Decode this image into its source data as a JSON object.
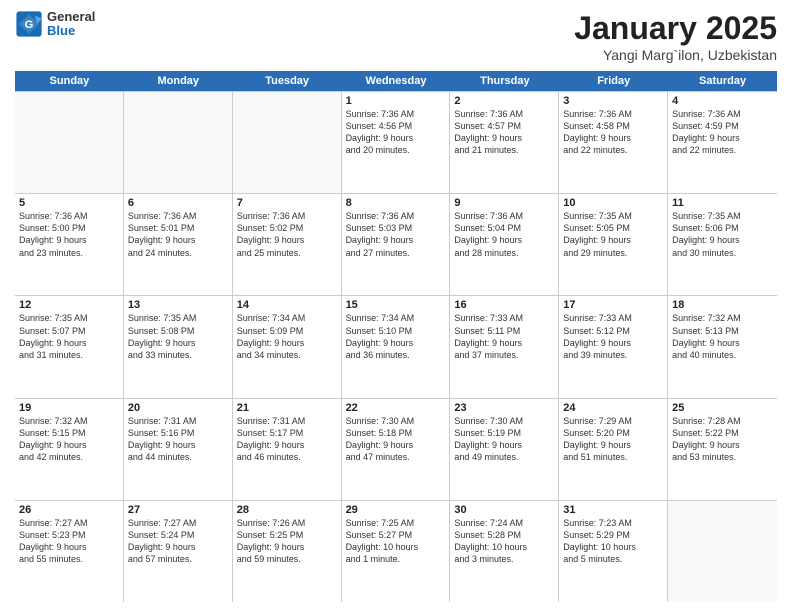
{
  "header": {
    "logo": {
      "line1": "General",
      "line2": "Blue"
    },
    "title": "January 2025",
    "subtitle": "Yangi Marg`ilon, Uzbekistan"
  },
  "weekdays": [
    "Sunday",
    "Monday",
    "Tuesday",
    "Wednesday",
    "Thursday",
    "Friday",
    "Saturday"
  ],
  "rows": [
    [
      {
        "day": "",
        "lines": []
      },
      {
        "day": "",
        "lines": []
      },
      {
        "day": "",
        "lines": []
      },
      {
        "day": "1",
        "lines": [
          "Sunrise: 7:36 AM",
          "Sunset: 4:56 PM",
          "Daylight: 9 hours",
          "and 20 minutes."
        ]
      },
      {
        "day": "2",
        "lines": [
          "Sunrise: 7:36 AM",
          "Sunset: 4:57 PM",
          "Daylight: 9 hours",
          "and 21 minutes."
        ]
      },
      {
        "day": "3",
        "lines": [
          "Sunrise: 7:36 AM",
          "Sunset: 4:58 PM",
          "Daylight: 9 hours",
          "and 22 minutes."
        ]
      },
      {
        "day": "4",
        "lines": [
          "Sunrise: 7:36 AM",
          "Sunset: 4:59 PM",
          "Daylight: 9 hours",
          "and 22 minutes."
        ]
      }
    ],
    [
      {
        "day": "5",
        "lines": [
          "Sunrise: 7:36 AM",
          "Sunset: 5:00 PM",
          "Daylight: 9 hours",
          "and 23 minutes."
        ]
      },
      {
        "day": "6",
        "lines": [
          "Sunrise: 7:36 AM",
          "Sunset: 5:01 PM",
          "Daylight: 9 hours",
          "and 24 minutes."
        ]
      },
      {
        "day": "7",
        "lines": [
          "Sunrise: 7:36 AM",
          "Sunset: 5:02 PM",
          "Daylight: 9 hours",
          "and 25 minutes."
        ]
      },
      {
        "day": "8",
        "lines": [
          "Sunrise: 7:36 AM",
          "Sunset: 5:03 PM",
          "Daylight: 9 hours",
          "and 27 minutes."
        ]
      },
      {
        "day": "9",
        "lines": [
          "Sunrise: 7:36 AM",
          "Sunset: 5:04 PM",
          "Daylight: 9 hours",
          "and 28 minutes."
        ]
      },
      {
        "day": "10",
        "lines": [
          "Sunrise: 7:35 AM",
          "Sunset: 5:05 PM",
          "Daylight: 9 hours",
          "and 29 minutes."
        ]
      },
      {
        "day": "11",
        "lines": [
          "Sunrise: 7:35 AM",
          "Sunset: 5:06 PM",
          "Daylight: 9 hours",
          "and 30 minutes."
        ]
      }
    ],
    [
      {
        "day": "12",
        "lines": [
          "Sunrise: 7:35 AM",
          "Sunset: 5:07 PM",
          "Daylight: 9 hours",
          "and 31 minutes."
        ]
      },
      {
        "day": "13",
        "lines": [
          "Sunrise: 7:35 AM",
          "Sunset: 5:08 PM",
          "Daylight: 9 hours",
          "and 33 minutes."
        ]
      },
      {
        "day": "14",
        "lines": [
          "Sunrise: 7:34 AM",
          "Sunset: 5:09 PM",
          "Daylight: 9 hours",
          "and 34 minutes."
        ]
      },
      {
        "day": "15",
        "lines": [
          "Sunrise: 7:34 AM",
          "Sunset: 5:10 PM",
          "Daylight: 9 hours",
          "and 36 minutes."
        ]
      },
      {
        "day": "16",
        "lines": [
          "Sunrise: 7:33 AM",
          "Sunset: 5:11 PM",
          "Daylight: 9 hours",
          "and 37 minutes."
        ]
      },
      {
        "day": "17",
        "lines": [
          "Sunrise: 7:33 AM",
          "Sunset: 5:12 PM",
          "Daylight: 9 hours",
          "and 39 minutes."
        ]
      },
      {
        "day": "18",
        "lines": [
          "Sunrise: 7:32 AM",
          "Sunset: 5:13 PM",
          "Daylight: 9 hours",
          "and 40 minutes."
        ]
      }
    ],
    [
      {
        "day": "19",
        "lines": [
          "Sunrise: 7:32 AM",
          "Sunset: 5:15 PM",
          "Daylight: 9 hours",
          "and 42 minutes."
        ]
      },
      {
        "day": "20",
        "lines": [
          "Sunrise: 7:31 AM",
          "Sunset: 5:16 PM",
          "Daylight: 9 hours",
          "and 44 minutes."
        ]
      },
      {
        "day": "21",
        "lines": [
          "Sunrise: 7:31 AM",
          "Sunset: 5:17 PM",
          "Daylight: 9 hours",
          "and 46 minutes."
        ]
      },
      {
        "day": "22",
        "lines": [
          "Sunrise: 7:30 AM",
          "Sunset: 5:18 PM",
          "Daylight: 9 hours",
          "and 47 minutes."
        ]
      },
      {
        "day": "23",
        "lines": [
          "Sunrise: 7:30 AM",
          "Sunset: 5:19 PM",
          "Daylight: 9 hours",
          "and 49 minutes."
        ]
      },
      {
        "day": "24",
        "lines": [
          "Sunrise: 7:29 AM",
          "Sunset: 5:20 PM",
          "Daylight: 9 hours",
          "and 51 minutes."
        ]
      },
      {
        "day": "25",
        "lines": [
          "Sunrise: 7:28 AM",
          "Sunset: 5:22 PM",
          "Daylight: 9 hours",
          "and 53 minutes."
        ]
      }
    ],
    [
      {
        "day": "26",
        "lines": [
          "Sunrise: 7:27 AM",
          "Sunset: 5:23 PM",
          "Daylight: 9 hours",
          "and 55 minutes."
        ]
      },
      {
        "day": "27",
        "lines": [
          "Sunrise: 7:27 AM",
          "Sunset: 5:24 PM",
          "Daylight: 9 hours",
          "and 57 minutes."
        ]
      },
      {
        "day": "28",
        "lines": [
          "Sunrise: 7:26 AM",
          "Sunset: 5:25 PM",
          "Daylight: 9 hours",
          "and 59 minutes."
        ]
      },
      {
        "day": "29",
        "lines": [
          "Sunrise: 7:25 AM",
          "Sunset: 5:27 PM",
          "Daylight: 10 hours",
          "and 1 minute."
        ]
      },
      {
        "day": "30",
        "lines": [
          "Sunrise: 7:24 AM",
          "Sunset: 5:28 PM",
          "Daylight: 10 hours",
          "and 3 minutes."
        ]
      },
      {
        "day": "31",
        "lines": [
          "Sunrise: 7:23 AM",
          "Sunset: 5:29 PM",
          "Daylight: 10 hours",
          "and 5 minutes."
        ]
      },
      {
        "day": "",
        "lines": []
      }
    ]
  ]
}
